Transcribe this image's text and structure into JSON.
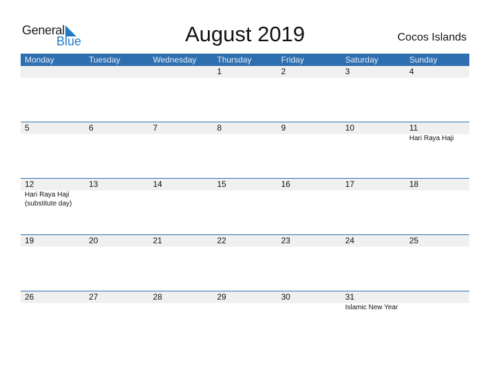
{
  "logo": {
    "line1": "General",
    "line2": "Blue"
  },
  "title": "August 2019",
  "country": "Cocos Islands",
  "colors": {
    "header_bg": "#2e6fb0",
    "accent": "#1f7ac8",
    "date_strip": "#f0f0f0"
  },
  "weekdays": [
    "Monday",
    "Tuesday",
    "Wednesday",
    "Thursday",
    "Friday",
    "Saturday",
    "Sunday"
  ],
  "weeks": [
    {
      "days": [
        {
          "num": "",
          "event": ""
        },
        {
          "num": "",
          "event": ""
        },
        {
          "num": "",
          "event": ""
        },
        {
          "num": "1",
          "event": ""
        },
        {
          "num": "2",
          "event": ""
        },
        {
          "num": "3",
          "event": ""
        },
        {
          "num": "4",
          "event": ""
        }
      ]
    },
    {
      "days": [
        {
          "num": "5",
          "event": ""
        },
        {
          "num": "6",
          "event": ""
        },
        {
          "num": "7",
          "event": ""
        },
        {
          "num": "8",
          "event": ""
        },
        {
          "num": "9",
          "event": ""
        },
        {
          "num": "10",
          "event": ""
        },
        {
          "num": "11",
          "event": "Hari Raya Haji"
        }
      ]
    },
    {
      "days": [
        {
          "num": "12",
          "event": "Hari Raya Haji (substitute day)"
        },
        {
          "num": "13",
          "event": ""
        },
        {
          "num": "14",
          "event": ""
        },
        {
          "num": "15",
          "event": ""
        },
        {
          "num": "16",
          "event": ""
        },
        {
          "num": "17",
          "event": ""
        },
        {
          "num": "18",
          "event": ""
        }
      ]
    },
    {
      "days": [
        {
          "num": "19",
          "event": ""
        },
        {
          "num": "20",
          "event": ""
        },
        {
          "num": "21",
          "event": ""
        },
        {
          "num": "22",
          "event": ""
        },
        {
          "num": "23",
          "event": ""
        },
        {
          "num": "24",
          "event": ""
        },
        {
          "num": "25",
          "event": ""
        }
      ]
    },
    {
      "days": [
        {
          "num": "26",
          "event": ""
        },
        {
          "num": "27",
          "event": ""
        },
        {
          "num": "28",
          "event": ""
        },
        {
          "num": "29",
          "event": ""
        },
        {
          "num": "30",
          "event": ""
        },
        {
          "num": "31",
          "event": "Islamic New Year"
        },
        {
          "num": "",
          "event": ""
        }
      ]
    }
  ]
}
